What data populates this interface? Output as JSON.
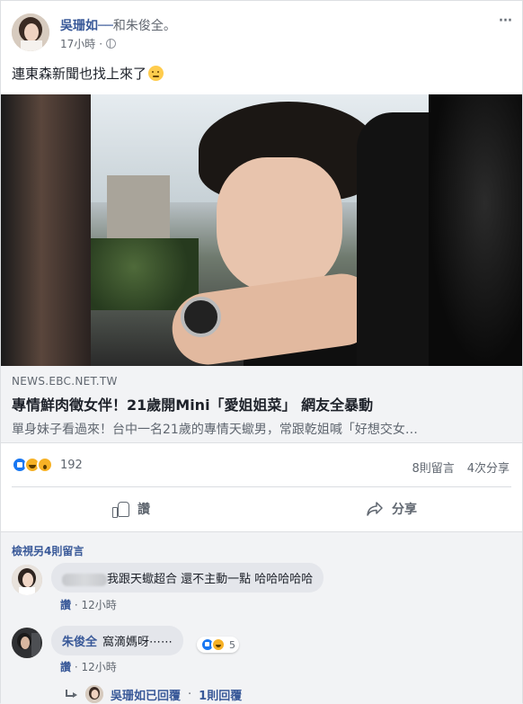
{
  "post": {
    "author": "吳珊如──",
    "with_text": "和朱俊全。",
    "time": "17小時",
    "more_icon": "more-horizontal-icon",
    "privacy_icon": "globe-icon",
    "status_text": "連東森新聞也找上來了",
    "status_emoji": "thinking-face-emoji"
  },
  "link": {
    "domain": "NEWS.EBC.NET.TW",
    "title": "專情鮮肉徵女伴！21歲開Mini「愛姐姐菜」 網友全暴動",
    "description": "單身妹子看過來！台中一名21歲的專情天蠍男，常跟乾姐喊「好想交女…"
  },
  "stats": {
    "reaction_count": "192",
    "comments": "8則留言",
    "shares": "4次分享",
    "reaction_types": [
      "like",
      "haha",
      "wow"
    ]
  },
  "actions": {
    "like_label": "讚",
    "share_label": "分享"
  },
  "comments": {
    "view_more": "檢視另4則留言",
    "items": [
      {
        "author": "",
        "text": "我跟天蠍超合 還不主動一點 哈哈哈哈哈",
        "like_label": "讚",
        "time": "12小時"
      },
      {
        "author": "朱俊全",
        "text": "窩滴媽呀⋯⋯",
        "reaction_count": "5",
        "like_label": "讚",
        "time": "12小時"
      }
    ],
    "replies": {
      "author": "吳珊如已回覆",
      "separator": "·",
      "count": "1則回覆"
    }
  },
  "colors": {
    "link_blue": "#385898",
    "like_blue": "#1877f2",
    "haha_yellow": "#f7b125",
    "bg_gray": "#f2f3f5"
  }
}
